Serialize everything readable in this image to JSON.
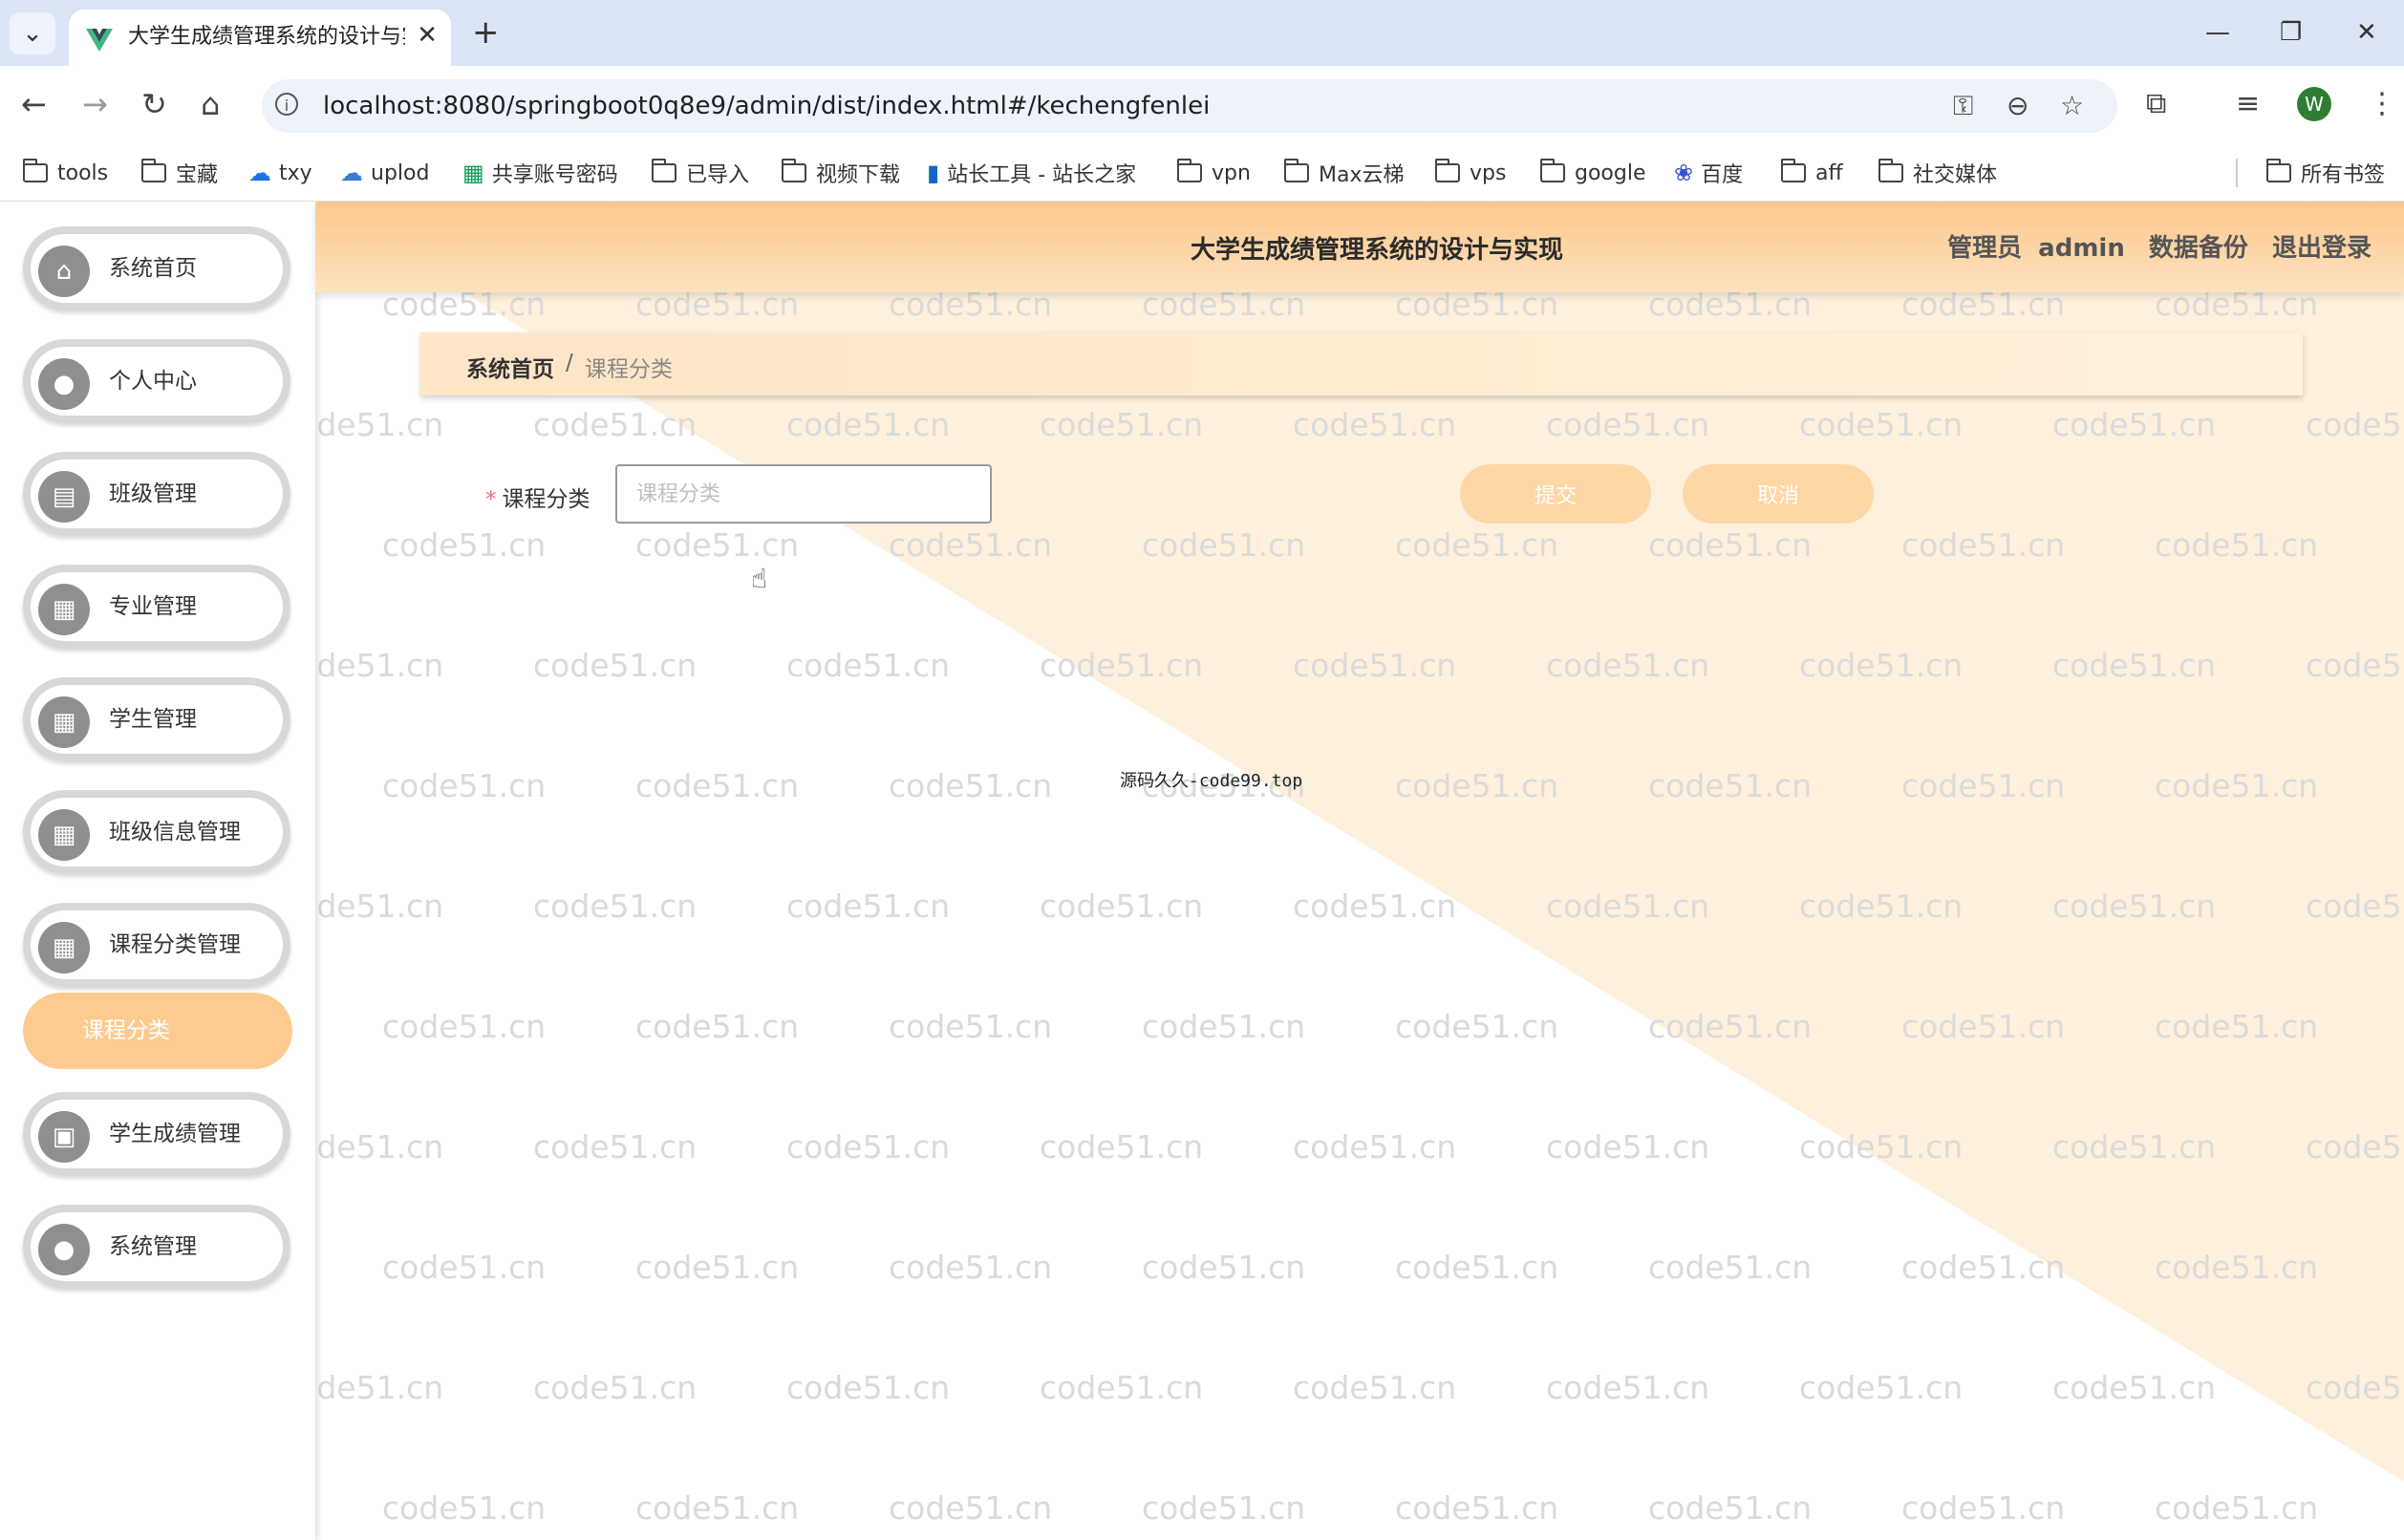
{
  "browser": {
    "tab_title": "大学生成绩管理系统的设计与实",
    "url": "localhost:8080/springboot0q8e9/admin/dist/index.html#/kechengfenlei",
    "profile_initial": "W",
    "bookmarks": [
      {
        "label": "tools",
        "icon": "folder-icon"
      },
      {
        "label": "宝藏",
        "icon": "folder-icon"
      },
      {
        "label": "txy",
        "icon": "cloud-icon"
      },
      {
        "label": "uplod",
        "icon": "cloud-icon"
      },
      {
        "label": "共享账号密码",
        "icon": "sheet-icon"
      },
      {
        "label": "已导入",
        "icon": "folder-icon"
      },
      {
        "label": "视频下载",
        "icon": "folder-icon"
      },
      {
        "label": "站长工具 - 站长之家",
        "icon": "site-icon"
      },
      {
        "label": "vpn",
        "icon": "folder-icon"
      },
      {
        "label": "Max云梯",
        "icon": "folder-icon"
      },
      {
        "label": "vps",
        "icon": "folder-icon"
      },
      {
        "label": "google",
        "icon": "folder-icon"
      },
      {
        "label": "百度",
        "icon": "paw-icon"
      },
      {
        "label": "aff",
        "icon": "folder-icon"
      },
      {
        "label": "社交媒体",
        "icon": "folder-icon"
      }
    ],
    "all_bookmarks": "所有书签"
  },
  "watermark_text": "code51.cn",
  "header": {
    "title": "大学生成绩管理系统的设计与实现",
    "role_label": "管理员",
    "username": "admin",
    "backup": "数据备份",
    "logout": "退出登录"
  },
  "sidebar": {
    "items": [
      {
        "label": "系统首页",
        "icon": "home-icon"
      },
      {
        "label": "个人中心",
        "icon": "user-icon"
      },
      {
        "label": "班级管理",
        "icon": "clipboard-icon"
      },
      {
        "label": "专业管理",
        "icon": "grid-icon"
      },
      {
        "label": "学生管理",
        "icon": "grid-icon"
      },
      {
        "label": "班级信息管理",
        "icon": "grid-icon"
      },
      {
        "label": "课程分类管理",
        "icon": "grid-icon"
      },
      {
        "label": "学生成绩管理",
        "icon": "briefcase-icon"
      },
      {
        "label": "系统管理",
        "icon": "user-icon"
      }
    ],
    "active_sub_item": "课程分类"
  },
  "breadcrumb": {
    "home": "系统首页",
    "separator": "/",
    "current": "课程分类"
  },
  "form": {
    "label": "课程分类",
    "required_mark": "*",
    "placeholder": "课程分类",
    "value": "",
    "submit": "提交",
    "cancel": "取消"
  },
  "center_note": "源码久久-code99.top",
  "colors": {
    "accent": "#fdcb8f",
    "header_gradient_top": "#fdc78c",
    "button_bg": "#fdd7a6",
    "background_triangle": "#fef0dc"
  }
}
